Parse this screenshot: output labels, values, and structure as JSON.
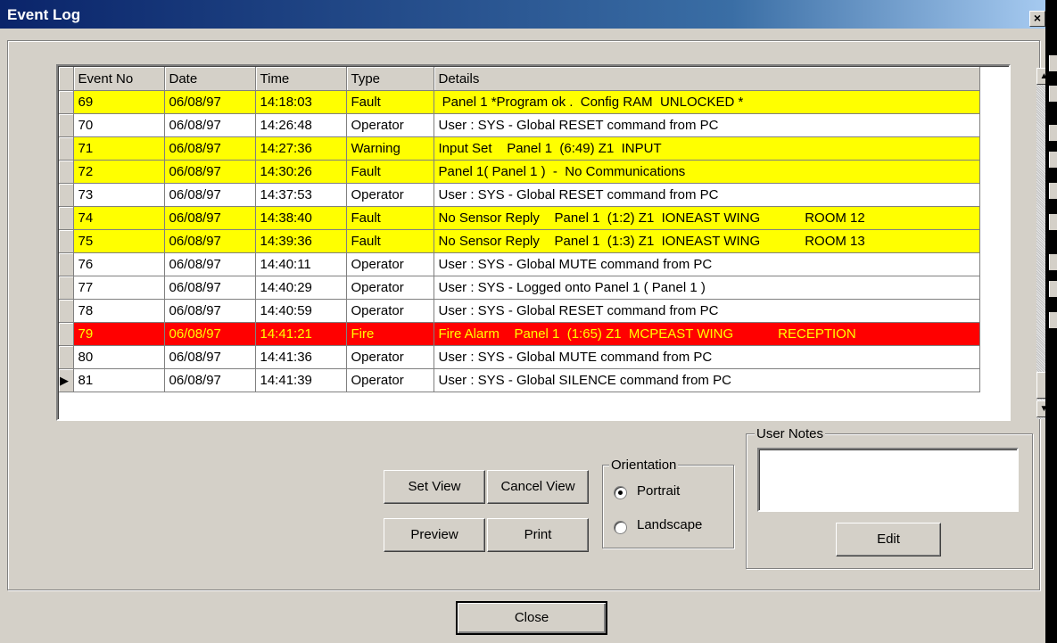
{
  "window": {
    "title": "Event Log",
    "close_glyph": "×"
  },
  "grid": {
    "columns": [
      "Event No",
      "Date",
      "Time",
      "Type",
      "Details"
    ],
    "rows": [
      {
        "no": "69",
        "date": "06/08/97",
        "time": "14:18:03",
        "type": "Fault",
        "details": " Panel 1 *Program ok .  Config RAM  UNLOCKED *",
        "style": "fault"
      },
      {
        "no": "70",
        "date": "06/08/97",
        "time": "14:26:48",
        "type": "Operator",
        "details": "User : SYS - Global RESET command from PC",
        "style": "normal"
      },
      {
        "no": "71",
        "date": "06/08/97",
        "time": "14:27:36",
        "type": "Warning",
        "details": "Input Set    Panel 1  (6:49) Z1  INPUT",
        "style": "fault"
      },
      {
        "no": "72",
        "date": "06/08/97",
        "time": "14:30:26",
        "type": "Fault",
        "details": "Panel 1( Panel 1 )  -  No Communications",
        "style": "fault"
      },
      {
        "no": "73",
        "date": "06/08/97",
        "time": "14:37:53",
        "type": "Operator",
        "details": "User : SYS - Global RESET command from PC",
        "style": "normal"
      },
      {
        "no": "74",
        "date": "06/08/97",
        "time": "14:38:40",
        "type": "Fault",
        "details": "No Sensor Reply    Panel 1  (1:2) Z1  IONEAST WING            ROOM 12",
        "style": "fault"
      },
      {
        "no": "75",
        "date": "06/08/97",
        "time": "14:39:36",
        "type": "Fault",
        "details": "No Sensor Reply    Panel 1  (1:3) Z1  IONEAST WING            ROOM 13",
        "style": "fault"
      },
      {
        "no": "76",
        "date": "06/08/97",
        "time": "14:40:11",
        "type": "Operator",
        "details": "User : SYS - Global MUTE command from PC",
        "style": "normal"
      },
      {
        "no": "77",
        "date": "06/08/97",
        "time": "14:40:29",
        "type": "Operator",
        "details": "User : SYS - Logged onto Panel 1 ( Panel 1 )",
        "style": "normal"
      },
      {
        "no": "78",
        "date": "06/08/97",
        "time": "14:40:59",
        "type": "Operator",
        "details": "User : SYS - Global RESET command from PC",
        "style": "normal"
      },
      {
        "no": "79",
        "date": "06/08/97",
        "time": "14:41:21",
        "type": "Fire",
        "details": "Fire Alarm    Panel 1  (1:65) Z1  MCPEAST WING            RECEPTION",
        "style": "fire"
      },
      {
        "no": "80",
        "date": "06/08/97",
        "time": "14:41:36",
        "type": "Operator",
        "details": "User : SYS - Global MUTE command from PC",
        "style": "normal"
      },
      {
        "no": "81",
        "date": "06/08/97",
        "time": "14:41:39",
        "type": "Operator",
        "details": "User : SYS - Global SILENCE command from PC",
        "style": "normal",
        "current": true
      }
    ],
    "current_row_glyph": "▶",
    "scroll_up_glyph": "▲",
    "scroll_down_glyph": "▼"
  },
  "buttons": {
    "set_view": "Set View",
    "cancel_view": "Cancel View",
    "preview": "Preview",
    "print": "Print",
    "edit": "Edit",
    "close": "Close"
  },
  "orientation": {
    "legend": "Orientation",
    "options": [
      "Portrait",
      "Landscape"
    ],
    "selected": "Portrait"
  },
  "user_notes": {
    "legend": "User Notes",
    "value": ""
  },
  "colors": {
    "fault_row": "#ffff00",
    "fire_row": "#ff0000",
    "fire_text": "#ffff00",
    "title_bar": "#0a246a"
  }
}
